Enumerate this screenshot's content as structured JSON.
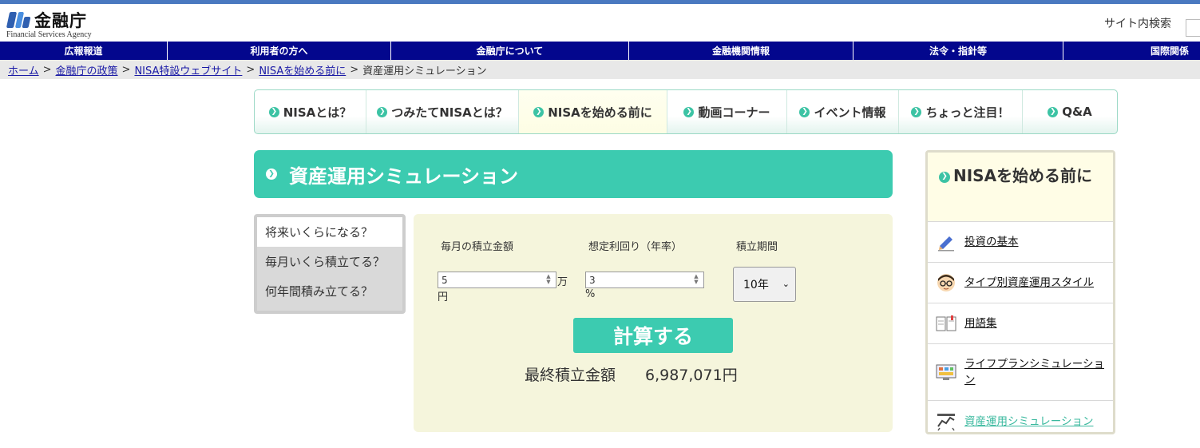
{
  "header": {
    "logo_text": "金融庁",
    "logo_sub": "Financial Services Agency",
    "search_label": "サイト内検索"
  },
  "global_nav": [
    "広報報道",
    "利用者の方へ",
    "金融庁について",
    "金融機関情報",
    "法令・指針等",
    "国際関係"
  ],
  "breadcrumb": {
    "links": [
      "ホーム",
      "金融庁の政策",
      "NISA特設ウェブサイト",
      "NISAを始める前に"
    ],
    "current": "資産運用シミュレーション",
    "separator": ">"
  },
  "tabs": [
    "NISAとは？",
    "つみたてNISAとは？",
    "NISAを始める前に",
    "動画コーナー",
    "イベント情報",
    "ちょっと注目！",
    "Q&A"
  ],
  "page_title": "資産運用シミュレーション",
  "selector_menu": [
    "将来いくらになる？",
    "毎月いくら積立てる？",
    "何年間積み立てる？"
  ],
  "form": {
    "monthly_label": "毎月の積立金額",
    "monthly_value": "5",
    "monthly_unit_1": "万",
    "monthly_unit_2": "円",
    "rate_label": "想定利回り（年率）",
    "rate_value": "3",
    "rate_unit": "%",
    "period_label": "積立期間",
    "period_value": "10年",
    "calc_button": "計算する",
    "result_label": "最終積立金額",
    "result_value": "6,987,071円"
  },
  "sidebar": {
    "heading": "NISAを始める前に",
    "items": [
      {
        "label": "投資の基本",
        "icon": "pencil-icon"
      },
      {
        "label": "タイプ別資産運用スタイル",
        "icon": "person-glasses-icon"
      },
      {
        "label": "用語集",
        "icon": "book-icon"
      },
      {
        "label": "ライフプランシミュレーション",
        "icon": "monitor-icon"
      },
      {
        "label": "資産運用シミュレーション",
        "icon": "chart-icon"
      }
    ]
  },
  "colors": {
    "accent": "#3ccbb0",
    "nav_bg": "#03078d",
    "panel_bg": "#f5f5dc",
    "link": "#1a1aa6"
  }
}
